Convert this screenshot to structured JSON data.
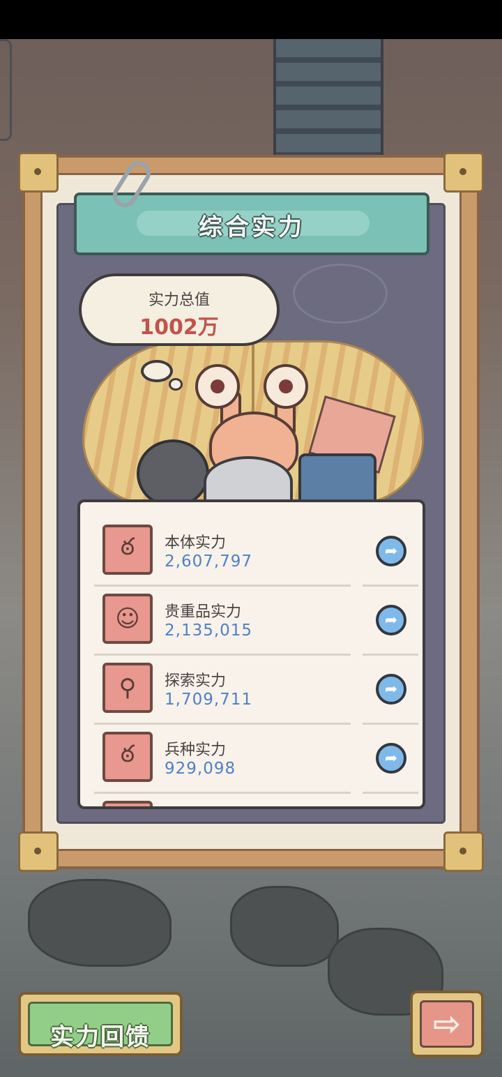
{
  "header": {
    "title": "综合实力"
  },
  "total": {
    "label": "实力总值",
    "value": "1002万"
  },
  "power_items": [
    {
      "label": "本体实力",
      "value": "2,607,797",
      "icon": "snail-wings-icon"
    },
    {
      "label": "贵重品实力",
      "value": "2,135,015",
      "icon": "bust-statue-icon"
    },
    {
      "label": "探索实力",
      "value": "1,709,711",
      "icon": "magnifier-icon"
    },
    {
      "label": "兵种实力",
      "value": "929,098",
      "icon": "troop-creature-icon"
    }
  ],
  "footer": {
    "feedback_label": "实力回馈"
  },
  "colors": {
    "accent_teal": "#7cc1b5",
    "value_blue": "#4f7fcb",
    "total_red": "#c2524a",
    "icon_pink": "#e8988e"
  }
}
